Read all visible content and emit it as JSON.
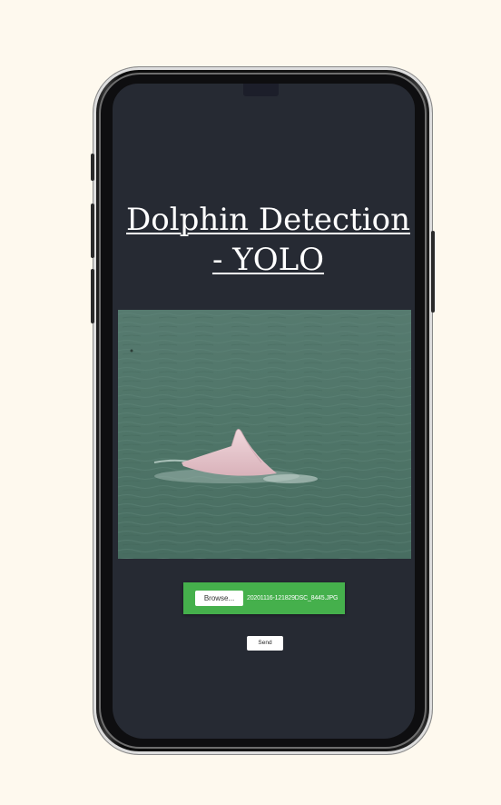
{
  "app": {
    "title": "Dolphin Detection - YOLO"
  },
  "image": {
    "subject": "pink dolphin in sea water",
    "colors": {
      "water": "#4f7568",
      "dolphin": "#e8c9cf"
    }
  },
  "upload": {
    "browse_label": "Browse...",
    "file_name": "20201116-121829DSC_8445.JPG"
  },
  "actions": {
    "send_label": "Send"
  },
  "colors": {
    "page_background": "#fef9ee",
    "screen_background": "#262a33",
    "upload_bar": "#45b04c"
  }
}
